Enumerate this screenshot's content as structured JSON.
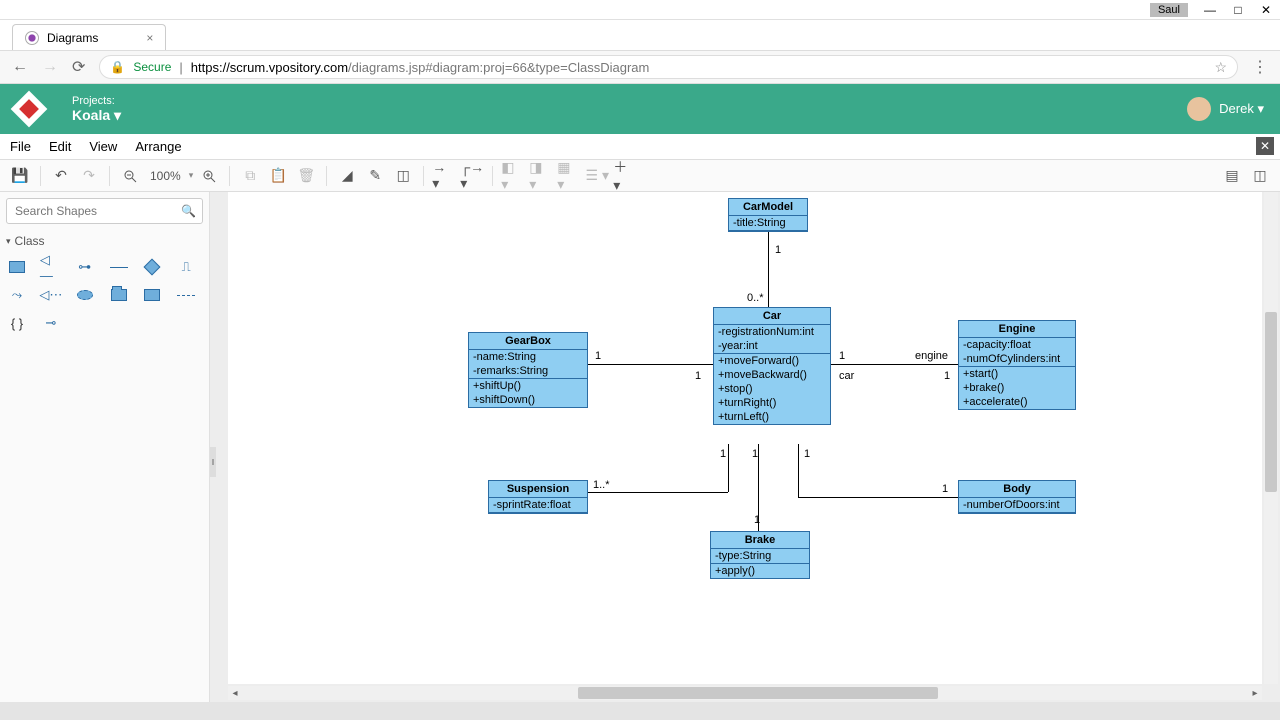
{
  "window": {
    "os_user": "Saul"
  },
  "browser": {
    "tab_title": "Diagrams",
    "secure_label": "Secure",
    "url_host": "https://scrum.vpository.com",
    "url_path": "/diagrams.jsp#diagram:proj=66&type=ClassDiagram"
  },
  "app": {
    "projects_label": "Projects:",
    "project_name": "Koala",
    "user_name": "Derek"
  },
  "menu": {
    "file": "File",
    "edit": "Edit",
    "view": "View",
    "arrange": "Arrange"
  },
  "toolbar": {
    "zoom": "100%"
  },
  "sidepanel": {
    "search_placeholder": "Search Shapes",
    "section_class": "Class"
  },
  "diagram": {
    "CarModel": {
      "title": "CarModel",
      "attrs": [
        "-title:String"
      ]
    },
    "Car": {
      "title": "Car",
      "attrs": [
        "-registrationNum:int",
        "-year:int"
      ],
      "ops": [
        "+moveForward()",
        "+moveBackward()",
        "+stop()",
        "+turnRight()",
        "+turnLeft()"
      ]
    },
    "GearBox": {
      "title": "GearBox",
      "attrs": [
        "-name:String",
        "-remarks:String"
      ],
      "ops": [
        "+shiftUp()",
        "+shiftDown()"
      ]
    },
    "Engine": {
      "title": "Engine",
      "attrs": [
        "-capacity:float",
        "-numOfCylinders:int"
      ],
      "ops": [
        "+start()",
        "+brake()",
        "+accelerate()"
      ]
    },
    "Suspension": {
      "title": "Suspension",
      "attrs": [
        "-sprintRate:float"
      ]
    },
    "Body": {
      "title": "Body",
      "attrs": [
        "-numberOfDoors:int"
      ]
    },
    "Brake": {
      "title": "Brake",
      "attrs": [
        "-type:String"
      ],
      "ops": [
        "+apply()"
      ]
    },
    "labels": {
      "one": "1",
      "one_star": "1..*",
      "zero_star": "0..*",
      "engine": "engine",
      "car": "car"
    }
  }
}
